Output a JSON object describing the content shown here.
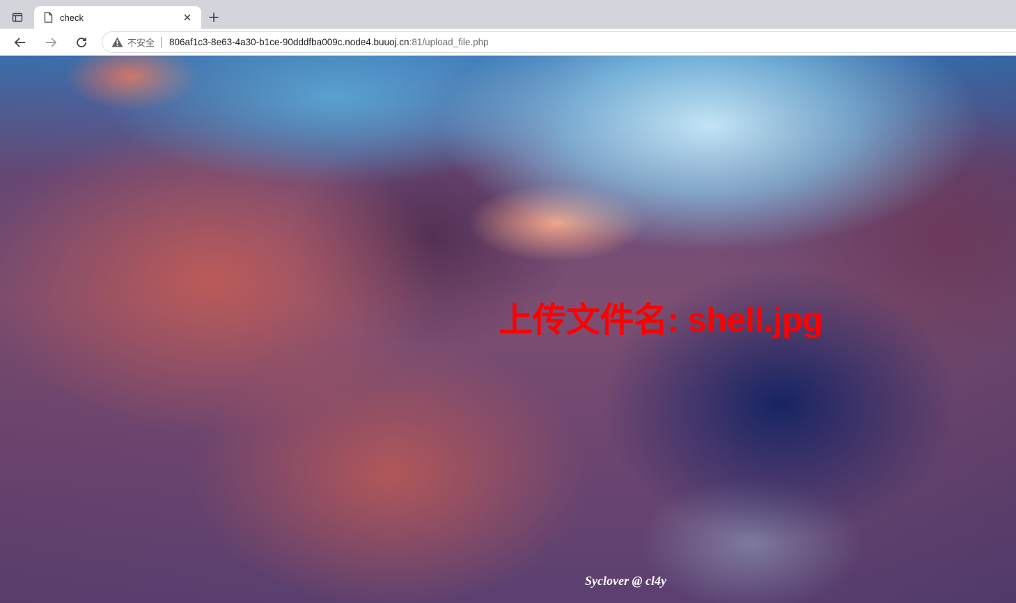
{
  "browser": {
    "tab": {
      "title": "check",
      "icon": "page-icon"
    },
    "toolbar": {
      "security_label": "不安全",
      "url_host": "806af1c3-8e63-4a30-b1ce-90dddfba009c.node4.buuoj.cn",
      "url_rest": ":81/upload_file.php"
    }
  },
  "page": {
    "message": "上传文件名: shell.jpg",
    "message_color": "#ff0000",
    "credit": "Syclover @ cl4y",
    "background": "cloudy sunset sky image"
  }
}
